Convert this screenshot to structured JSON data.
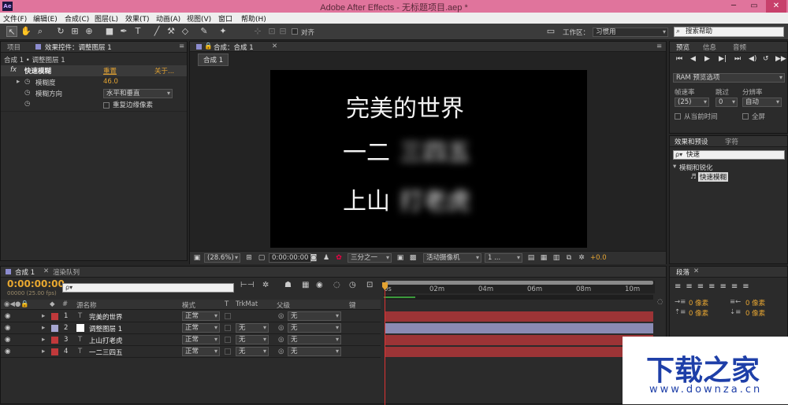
{
  "window": {
    "title": "Adobe After Effects - 无标题项目.aep *",
    "app_icon": "Ae",
    "buttons": {
      "minimize": "─",
      "maximize": "▭",
      "close": "✕"
    }
  },
  "menu": [
    "文件(F)",
    "编辑(E)",
    "合成(C)",
    "图层(L)",
    "效果(T)",
    "动画(A)",
    "视图(V)",
    "窗口",
    "帮助(H)"
  ],
  "toolbar": {
    "snap_label": "对齐",
    "workspace_label": "工作区：",
    "workspace_value": "习惯用",
    "search_help": "搜索帮助"
  },
  "effect_controls": {
    "tabs": [
      "项目",
      "效果控件：调整图层 1"
    ],
    "breadcrumb": "合成 1 • 调整图层 1",
    "effect": {
      "fx": "fx",
      "name": "快速模糊",
      "reset": "重置",
      "about": "关于..."
    },
    "properties": [
      {
        "name": "模糊度",
        "value": "46.0"
      },
      {
        "name": "模糊方向",
        "value": "水平和垂直"
      },
      {
        "name": "",
        "value": "重复边缘像素"
      }
    ]
  },
  "composition": {
    "tab": "合成：合成 1",
    "subtab": "合成 1",
    "text": {
      "line1": "完美的世界",
      "line2_clear": "一二",
      "line2_blur": "三四五",
      "line3_clear": "上山",
      "line3_blur": "打老虎"
    },
    "bottom": {
      "zoom": "(28.6%)",
      "timecode": "0:00:00:00",
      "resolution": "三分之一",
      "camera": "活动摄像机",
      "views": "1 ...",
      "exposure": "+0.0"
    }
  },
  "preview": {
    "tabs": [
      "预览",
      "信息",
      "音频"
    ],
    "ram_label": "RAM 预览选项",
    "fps_label": "帧速率",
    "skip_label": "跳过",
    "res_label": "分辨率",
    "fps_value": "(25)",
    "skip_value": "0",
    "res_value": "自动",
    "from_current": "从当前时间",
    "fullscreen": "全屏"
  },
  "effects_presets": {
    "tabs": [
      "效果和预设",
      "字符"
    ],
    "search": "快速",
    "category": "模糊和锐化",
    "item": "快速模糊"
  },
  "paragraph": {
    "tab": "段落",
    "zero1": "0 像素",
    "zero2": "0 像素",
    "zero3": "0 像素",
    "zero4": "0 像素",
    "zero5": "0 像素"
  },
  "timeline": {
    "tabs": [
      "合成 1",
      "渲染队列"
    ],
    "timecode": "0:00:00:00",
    "timecode_sub": "00000 (25.00 fps)",
    "search_placeholder": "ρ▾",
    "headers": {
      "num": "#",
      "name": "源名称",
      "mode": "模式",
      "t": "T",
      "trkmat": "TrkMat",
      "parent": "父级",
      "keys": "键"
    },
    "ruler": [
      "0s",
      "02m",
      "04m",
      "06m",
      "08m",
      "10m"
    ],
    "layers": [
      {
        "num": "1",
        "name": "完美的世界",
        "mode": "正常",
        "trkmat": "",
        "parent": "无",
        "color": "#c0393b"
      },
      {
        "num": "2",
        "name": "调整图层 1",
        "mode": "正常",
        "trkmat": "无",
        "parent": "无",
        "color": "#a6a6d0"
      },
      {
        "num": "3",
        "name": "上山打老虎",
        "mode": "正常",
        "trkmat": "无",
        "parent": "无",
        "color": "#c0393b"
      },
      {
        "num": "4",
        "name": "一二三四五",
        "mode": "正常",
        "trkmat": "无",
        "parent": "无",
        "color": "#c0393b"
      }
    ]
  },
  "watermark": {
    "brand": "下载之家",
    "url": "www.downza.cn"
  }
}
